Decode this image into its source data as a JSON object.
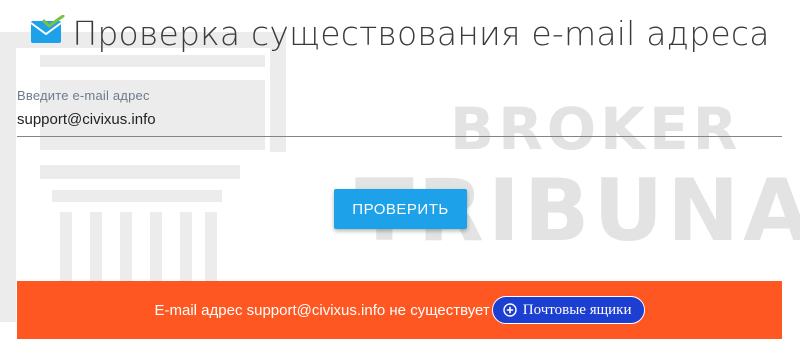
{
  "header": {
    "title": "Проверка существования e-mail адреса",
    "icon": "envelope-check-icon"
  },
  "form": {
    "label": "Введите e-mail адрес",
    "value": "support@civixus.info"
  },
  "actions": {
    "check_label": "ПРОВЕРИТЬ"
  },
  "result": {
    "message": "E-mail адрес support@civixus.info не существует",
    "mailbox_button_label": "Почтовые ящики",
    "mailbox_button_icon": "plus-circle-icon"
  },
  "watermark": {
    "line1": "BROKER",
    "line2": "TRIBUNAL"
  },
  "colors": {
    "accent": "#1da1e8",
    "error": "#ff5722",
    "mailbox_button": "#1c3ed1"
  }
}
